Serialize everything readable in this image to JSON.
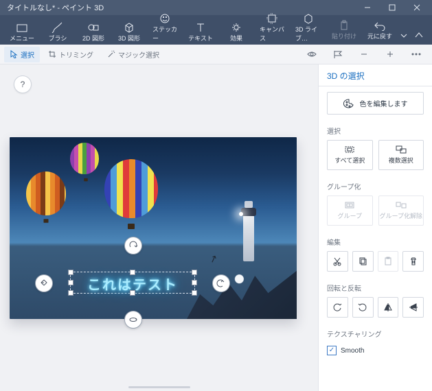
{
  "titlebar": {
    "title": "タイトルなし* - ペイント 3D"
  },
  "ribbon": {
    "menu": "メニュー",
    "brush": "ブラシ",
    "shapes2d": "2D 図形",
    "shapes3d": "3D 図形",
    "sticker": "ステッカー",
    "text": "テキスト",
    "effects": "効果",
    "canvas": "キャンバス",
    "library3d": "3D ライブ…",
    "paste": "貼り付け",
    "undo": "元に戻す"
  },
  "toolbar": {
    "select": "選択",
    "trimming": "トリミング",
    "magic": "マジック選択"
  },
  "help_tooltip": "?",
  "canvas_text": "これはテスト",
  "panel": {
    "header": "3D の選択",
    "edit_color": "色を編集します",
    "section_select": "選択",
    "select_all": "すべて選択",
    "multi_select": "複数選択",
    "section_group": "グループ化",
    "group": "グループ",
    "ungroup": "グループ化解除",
    "section_edit": "編集",
    "section_rotate": "回転と反転",
    "section_texture": "テクスチャリング",
    "smooth": "Smooth"
  }
}
